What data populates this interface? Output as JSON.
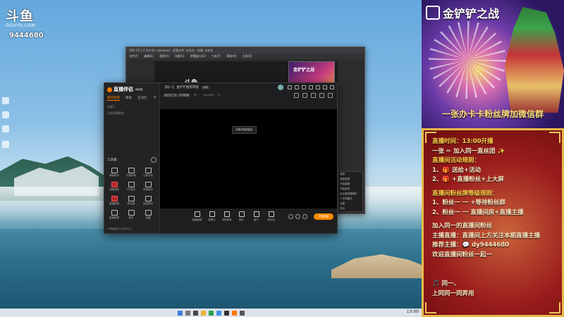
{
  "overlay": {
    "logo_text": "斗鱼",
    "logo_sub": "DOUYU.COM",
    "room_id": "9444680"
  },
  "back_window": {
    "title": "OBS 29.1.3 (64-bit, windows) - 配置文件: 未命名 - 场景: 未命名",
    "menu": [
      "文件(F)",
      "编辑(E)",
      "视图(V)",
      "场景(S)",
      "停靠窗口(D)",
      "工具(T)",
      "帮助(H)",
      "大屏(B)"
    ],
    "thumb_text": "金铲铲之战",
    "logo_text": "斗鱼",
    "panel_items": [
      "音频",
      "桌面音频",
      "开始直播",
      "开始录制",
      "启动虚拟摄像机",
      "工作室模式",
      "设置",
      "退出"
    ]
  },
  "app": {
    "name": "直播伴侣",
    "version": "v7.0",
    "tabs": [
      "我的场景",
      "模板",
      "互动区"
    ],
    "active_tab": "我的场景",
    "scene_rows": [
      "场景1",
      "添加直播素材"
    ],
    "tools_title": "工具箱",
    "tools": [
      {
        "label": "弹幕助手",
        "hot": false
      },
      {
        "label": "礼物特效",
        "hot": false
      },
      {
        "label": "公屏互动",
        "hot": false
      },
      {
        "label": "视频连麦",
        "hot": true
      },
      {
        "label": "PK连线",
        "hot": false
      },
      {
        "label": "房管助手",
        "hot": false
      },
      {
        "label": "直播数据",
        "hot": true
      },
      {
        "label": "粉丝团",
        "hot": false
      },
      {
        "label": "抽奖助手",
        "hot": false
      },
      {
        "label": "直播管理",
        "hot": false
      },
      {
        "label": "更多",
        "hot": false
      },
      {
        "label": "设置",
        "hot": false
      }
    ],
    "side_footer": "小屏道具中心任务中心",
    "room_title": "【同一】 金铲铲推荐阵容",
    "room_tag": "编辑",
    "category": "金铲铲之战 · 手机直播",
    "sub_meta": [
      "同一·",
      "9444680",
      "11"
    ],
    "preview_button": "分离开始按钮区",
    "bottom_tools": [
      "直播画面",
      "摄像头",
      "录制场景",
      "图片",
      "窗口",
      "麦克风"
    ],
    "start_button": "开始直播"
  },
  "ad": {
    "title": "金铲铲之战",
    "slogan": "一张办卡卡粉丝牌加微信群"
  },
  "info": {
    "lines": [
      {
        "text": "直播时间：13:00开播",
        "cls": "title"
      },
      {
        "text": "一张 ✏ 加入同一直丝团 ✨",
        "cls": "norm"
      },
      {
        "text": "直播间活动规则：",
        "cls": "title"
      },
      {
        "text": "1、🎁 送给+活动",
        "cls": "norm"
      },
      {
        "text": "2、🎁 +直播粉丝+上大屏",
        "cls": "norm"
      },
      {
        "text": "直播间粉丝牌等级规则：",
        "cls": "title gap"
      },
      {
        "text": "1、粉丝一 一 +等待粉丝群",
        "cls": "norm"
      },
      {
        "text": "2、粉丝一 一 直播间房+直播主播",
        "cls": "norm"
      },
      {
        "text": "加入同一的直播间粉丝",
        "cls": "norm gap"
      },
      {
        "text": "主播直播：直播间上方关注本期直播主播",
        "cls": "norm"
      },
      {
        "text": "推荐主播：💬 dy9444680",
        "cls": "norm"
      },
      {
        "text": "欢迎直播间粉丝一起一",
        "cls": "norm"
      }
    ],
    "footer": [
      "🎵 同一、",
      "上同同一同弄用"
    ]
  },
  "taskbar": {
    "time": "13:00"
  },
  "colors": {
    "accent": "#ff7a00",
    "info_border": "#e9b94a",
    "info_title": "#ffd44a"
  }
}
